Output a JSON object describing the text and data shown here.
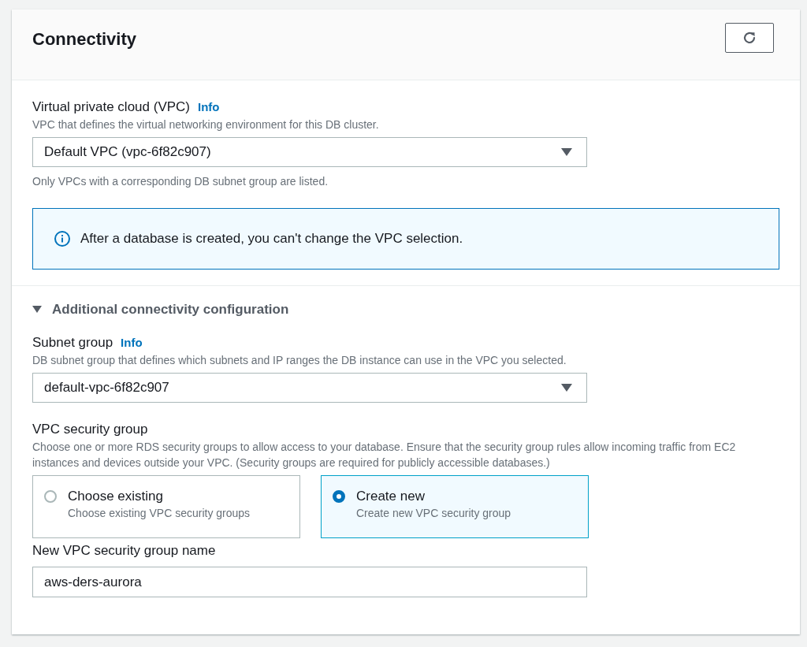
{
  "panel": {
    "title": "Connectivity"
  },
  "vpc": {
    "label": "Virtual private cloud (VPC)",
    "info": "Info",
    "description": "VPC that defines the virtual networking environment for this DB cluster.",
    "value": "Default VPC (vpc-6f82c907)",
    "hint": "Only VPCs with a corresponding DB subnet group are listed."
  },
  "alert": {
    "text": "After a database is created, you can't change the VPC selection."
  },
  "additional": {
    "label": "Additional connectivity configuration",
    "expanded": true
  },
  "subnet_group": {
    "label": "Subnet group",
    "info": "Info",
    "description": "DB subnet group that defines which subnets and IP ranges the DB instance can use in the VPC you selected.",
    "value": "default-vpc-6f82c907"
  },
  "security_group": {
    "label": "VPC security group",
    "description": "Choose one or more RDS security groups to allow access to your database. Ensure that the security group rules allow incoming traffic from EC2 instances and devices outside your VPC. (Security groups are required for publicly accessible databases.)",
    "options": [
      {
        "title": "Choose existing",
        "description": "Choose existing VPC security groups",
        "selected": false
      },
      {
        "title": "Create new",
        "description": "Create new VPC security group",
        "selected": true
      }
    ]
  },
  "new_group_name": {
    "label": "New VPC security group name",
    "value": "aws-ders-aurora"
  }
}
